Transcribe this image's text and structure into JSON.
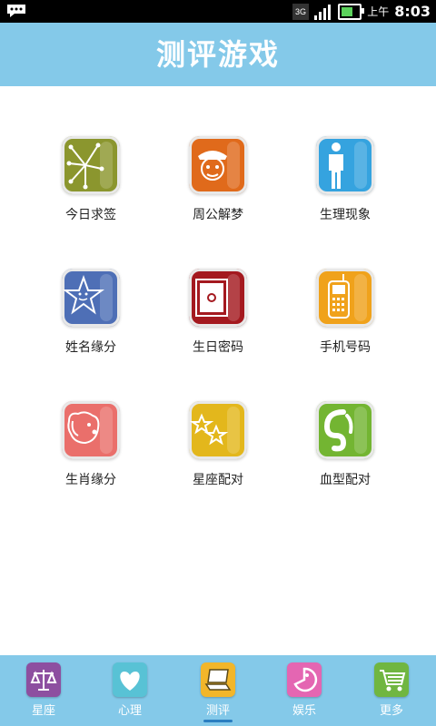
{
  "status": {
    "ampm": "上午",
    "time": "8:03",
    "network": "3G"
  },
  "header": {
    "title": "测评游戏"
  },
  "grid": [
    {
      "label": "今日求签",
      "icon": "fortune-sticks-icon",
      "color": "#8b962e"
    },
    {
      "label": "周公解梦",
      "icon": "police-face-icon",
      "color": "#e06a1b"
    },
    {
      "label": "生理现象",
      "icon": "human-body-icon",
      "color": "#35a3df"
    },
    {
      "label": "姓名缘分",
      "icon": "star-face-icon",
      "color": "#4e6fb6"
    },
    {
      "label": "生日密码",
      "icon": "safe-icon",
      "color": "#a4191f"
    },
    {
      "label": "手机号码",
      "icon": "mobile-phone-icon",
      "color": "#f0a21b"
    },
    {
      "label": "生肖缘分",
      "icon": "dog-icon",
      "color": "#ea6f6b"
    },
    {
      "label": "星座配对",
      "icon": "two-stars-icon",
      "color": "#e3b71c"
    },
    {
      "label": "血型配对",
      "icon": "swirl-icon",
      "color": "#73b532"
    }
  ],
  "nav": [
    {
      "label": "星座",
      "icon": "scales-icon",
      "color": "#8d4fa0"
    },
    {
      "label": "心理",
      "icon": "heart-icon",
      "color": "#58c2d5"
    },
    {
      "label": "测评",
      "icon": "laptop-icon",
      "color": "#f2b62a",
      "active": true
    },
    {
      "label": "娱乐",
      "icon": "pacman-face-icon",
      "color": "#e466b2"
    },
    {
      "label": "更多",
      "icon": "shopping-cart-icon",
      "color": "#70b641"
    }
  ]
}
